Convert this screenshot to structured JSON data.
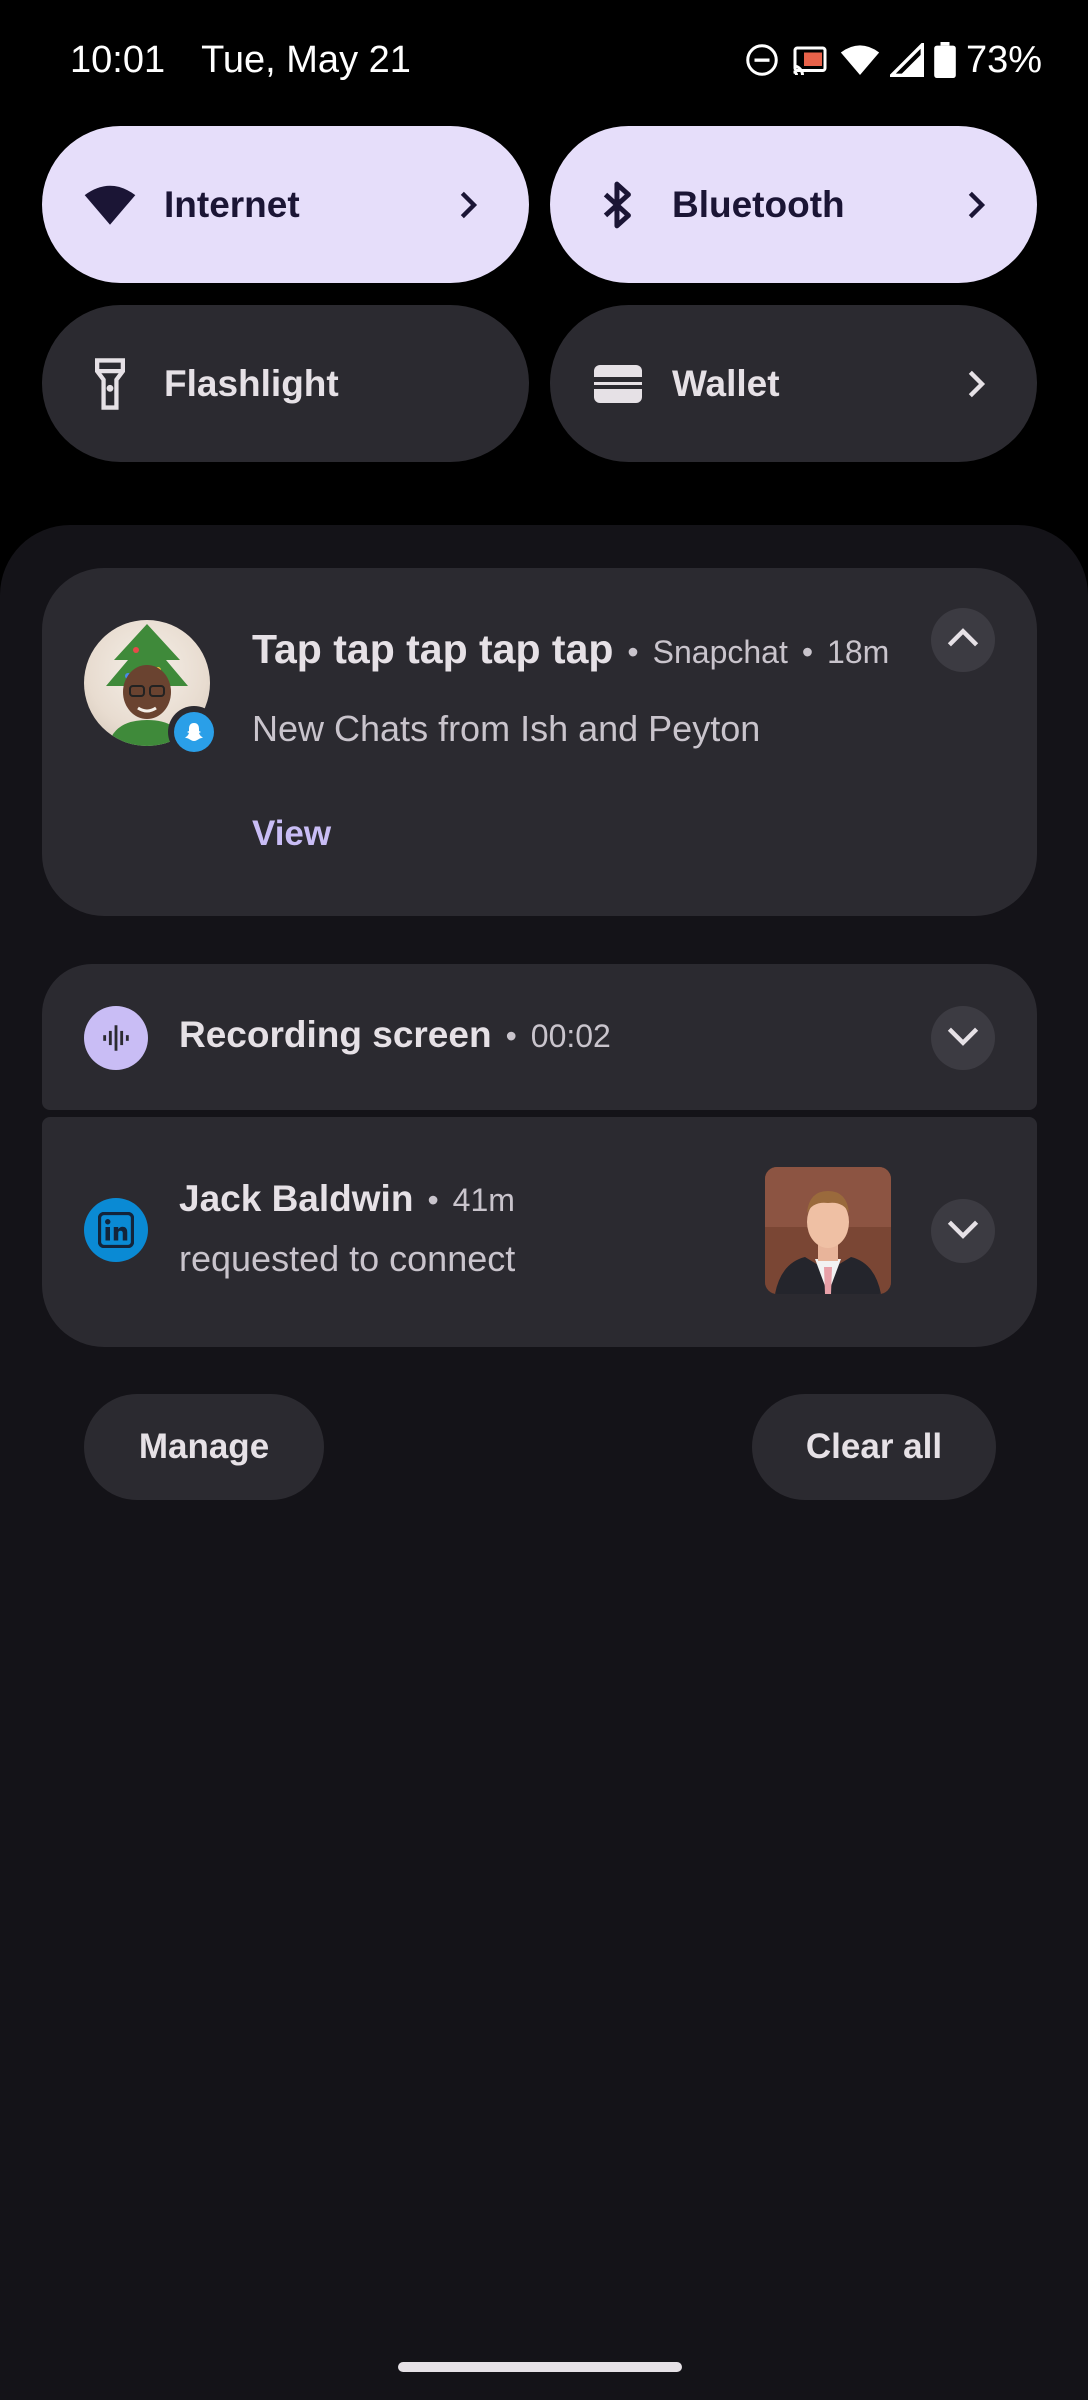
{
  "status_bar": {
    "time": "10:01",
    "date": "Tue, May 21",
    "battery_percent": "73%",
    "icons": [
      "do-not-disturb-icon",
      "cast-icon",
      "wifi-icon",
      "cell-signal-icon",
      "battery-icon"
    ]
  },
  "quick_settings": {
    "internet": {
      "label": "Internet",
      "icon": "wifi-icon",
      "active": true
    },
    "bluetooth": {
      "label": "Bluetooth",
      "icon": "bluetooth-icon",
      "active": true
    },
    "flashlight": {
      "label": "Flashlight",
      "icon": "flashlight-icon",
      "active": false
    },
    "wallet": {
      "label": "Wallet",
      "icon": "wallet-icon",
      "active": false
    }
  },
  "notifications": {
    "snapchat": {
      "title": "Tap tap tap tap tap",
      "separator": "•",
      "app": "Snapchat",
      "time": "18m",
      "body": "New Chats from Ish and Peyton",
      "action": "View"
    },
    "recording": {
      "title": "Recording screen",
      "separator": "•",
      "elapsed": "00:02"
    },
    "linkedin": {
      "title": "Jack Baldwin",
      "separator": "•",
      "time": "41m",
      "body": "requested to connect"
    }
  },
  "footer": {
    "manage_label": "Manage",
    "clear_all_label": "Clear all"
  },
  "colors": {
    "accent_tile": "#e6defa",
    "card_bg": "#2b2a30",
    "shade_bg": "#141318",
    "link_purple": "#c9bdf5",
    "linkedin_blue": "#0a8ad4"
  }
}
